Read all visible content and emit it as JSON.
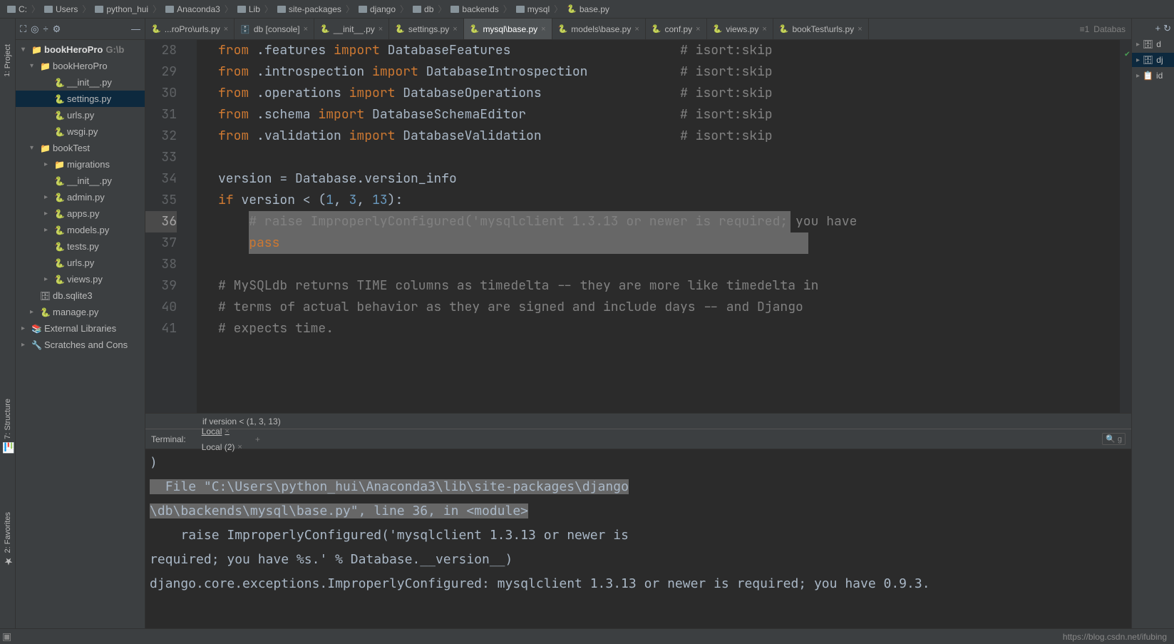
{
  "breadcrumb": [
    {
      "icon": "drive",
      "label": "C:"
    },
    {
      "icon": "folder",
      "label": "Users"
    },
    {
      "icon": "folder",
      "label": "python_hui"
    },
    {
      "icon": "folder",
      "label": "Anaconda3"
    },
    {
      "icon": "folder",
      "label": "Lib"
    },
    {
      "icon": "folder",
      "label": "site-packages"
    },
    {
      "icon": "folder",
      "label": "django"
    },
    {
      "icon": "folder",
      "label": "db"
    },
    {
      "icon": "folder",
      "label": "backends"
    },
    {
      "icon": "folder",
      "label": "mysql"
    },
    {
      "icon": "py",
      "label": "base.py"
    }
  ],
  "leftDock": {
    "project": "1: Project",
    "structure": "7: Structure",
    "favorites": "2: Favorites"
  },
  "projectTree": [
    {
      "depth": 0,
      "arrow": "▾",
      "icon": "📁",
      "label": "bookHeroPro",
      "suffix": " G:\\b",
      "bold": true
    },
    {
      "depth": 1,
      "arrow": "▾",
      "icon": "📁",
      "label": "bookHeroPro"
    },
    {
      "depth": 2,
      "arrow": "",
      "icon": "🐍",
      "label": "__init__.py"
    },
    {
      "depth": 2,
      "arrow": "",
      "icon": "🐍",
      "label": "settings.py",
      "selected": true
    },
    {
      "depth": 2,
      "arrow": "",
      "icon": "🐍",
      "label": "urls.py"
    },
    {
      "depth": 2,
      "arrow": "",
      "icon": "🐍",
      "label": "wsgi.py"
    },
    {
      "depth": 1,
      "arrow": "▾",
      "icon": "📁",
      "label": "bookTest"
    },
    {
      "depth": 2,
      "arrow": "▸",
      "icon": "📁",
      "label": "migrations"
    },
    {
      "depth": 2,
      "arrow": "",
      "icon": "🐍",
      "label": "__init__.py"
    },
    {
      "depth": 2,
      "arrow": "▸",
      "icon": "🐍",
      "label": "admin.py"
    },
    {
      "depth": 2,
      "arrow": "▸",
      "icon": "🐍",
      "label": "apps.py"
    },
    {
      "depth": 2,
      "arrow": "▸",
      "icon": "🐍",
      "label": "models.py"
    },
    {
      "depth": 2,
      "arrow": "",
      "icon": "🐍",
      "label": "tests.py"
    },
    {
      "depth": 2,
      "arrow": "",
      "icon": "🐍",
      "label": "urls.py"
    },
    {
      "depth": 2,
      "arrow": "▸",
      "icon": "🐍",
      "label": "views.py"
    },
    {
      "depth": 1,
      "arrow": "",
      "icon": "🗄",
      "label": "db.sqlite3"
    },
    {
      "depth": 1,
      "arrow": "▸",
      "icon": "🐍",
      "label": "manage.py"
    },
    {
      "depth": 0,
      "arrow": "▸",
      "icon": "📚",
      "label": "External Libraries"
    },
    {
      "depth": 0,
      "arrow": "▸",
      "icon": "🔧",
      "label": "Scratches and Cons"
    }
  ],
  "tabs": [
    {
      "icon": "py",
      "label": "...roPro\\urls.py"
    },
    {
      "icon": "db",
      "label": "db [console]"
    },
    {
      "icon": "py",
      "label": "__init__.py"
    },
    {
      "icon": "py",
      "label": "settings.py"
    },
    {
      "icon": "py",
      "label": "mysql\\base.py",
      "active": true
    },
    {
      "icon": "py",
      "label": "models\\base.py"
    },
    {
      "icon": "py",
      "label": "conf.py"
    },
    {
      "icon": "py",
      "label": "views.py"
    },
    {
      "icon": "py",
      "label": "bookTest\\urls.py"
    }
  ],
  "tabsRight": {
    "list": "≡1",
    "label": "Databas"
  },
  "code": {
    "startLine": 28,
    "lines": [
      {
        "n": 28,
        "seg": [
          [
            "kw",
            "from"
          ],
          [
            "op",
            " ."
          ],
          [
            "str-import",
            "features "
          ],
          [
            "kw",
            "import"
          ],
          [
            "op",
            " "
          ],
          [
            "str-import",
            "DatabaseFeatures"
          ]
        ],
        "comment": "# isort:skip"
      },
      {
        "n": 29,
        "seg": [
          [
            "kw",
            "from"
          ],
          [
            "op",
            " ."
          ],
          [
            "str-import",
            "introspection "
          ],
          [
            "kw",
            "import"
          ],
          [
            "op",
            " "
          ],
          [
            "str-import",
            "DatabaseIntrospection"
          ]
        ],
        "comment": "# isort:skip"
      },
      {
        "n": 30,
        "seg": [
          [
            "kw",
            "from"
          ],
          [
            "op",
            " ."
          ],
          [
            "str-import",
            "operations "
          ],
          [
            "kw",
            "import"
          ],
          [
            "op",
            " "
          ],
          [
            "str-import",
            "DatabaseOperations"
          ]
        ],
        "comment": "# isort:skip"
      },
      {
        "n": 31,
        "seg": [
          [
            "kw",
            "from"
          ],
          [
            "op",
            " ."
          ],
          [
            "str-import",
            "schema "
          ],
          [
            "kw",
            "import"
          ],
          [
            "op",
            " "
          ],
          [
            "str-import",
            "DatabaseSchemaEditor"
          ]
        ],
        "comment": "# isort:skip"
      },
      {
        "n": 32,
        "seg": [
          [
            "kw",
            "from"
          ],
          [
            "op",
            " ."
          ],
          [
            "str-import",
            "validation "
          ],
          [
            "kw",
            "import"
          ],
          [
            "op",
            " "
          ],
          [
            "str-import",
            "DatabaseValidation"
          ]
        ],
        "comment": "# isort:skip"
      },
      {
        "n": 33,
        "seg": []
      },
      {
        "n": 34,
        "seg": [
          [
            "op",
            "version = Database.version_info"
          ]
        ]
      },
      {
        "n": 35,
        "seg": [
          [
            "kw",
            "if"
          ],
          [
            "op",
            " version < ("
          ],
          [
            "num",
            "1"
          ],
          [
            "op",
            ", "
          ],
          [
            "num",
            "3"
          ],
          [
            "op",
            ", "
          ],
          [
            "num",
            "13"
          ],
          [
            "op",
            "):"
          ]
        ]
      },
      {
        "n": 36,
        "seg": [
          [
            "op",
            "    "
          ],
          [
            "cmt",
            "# raise ImproperlyConfigured('mysqlclient 1.3.13 or newer is required; you have"
          ]
        ],
        "highlighted": true,
        "active": true
      },
      {
        "n": 37,
        "seg": [
          [
            "op",
            "    "
          ],
          [
            "kw",
            "pass"
          ]
        ],
        "highlighted": true,
        "hl_end": 410
      },
      {
        "n": 38,
        "seg": []
      },
      {
        "n": 39,
        "seg": [
          [
            "cmt",
            "# MySQLdb returns TIME columns as timedelta -- they are more like timedelta in"
          ]
        ]
      },
      {
        "n": 40,
        "seg": [
          [
            "cmt",
            "# terms of actual behavior as they are signed and include days -- and Django"
          ]
        ]
      },
      {
        "n": 41,
        "seg": [
          [
            "cmt",
            "# expects time."
          ]
        ]
      }
    ],
    "crumb": "if version < (1, 3, 13)"
  },
  "rightDock": [
    {
      "icon": "🗄",
      "label": "d"
    },
    {
      "icon": "🗄",
      "label": "dj",
      "active": true
    },
    {
      "icon": "📋",
      "label": "id"
    }
  ],
  "terminalTabs": {
    "label": "Terminal:",
    "tabs": [
      {
        "label": "Local",
        "active": true
      },
      {
        "label": "Local (2)"
      }
    ]
  },
  "terminal": {
    "lines": [
      {
        "txt": ")"
      },
      {
        "txt": "  File \"C:\\Users\\python_hui\\Anaconda3\\lib\\site-packages\\django",
        "hl": true
      },
      {
        "txt": "\\db\\backends\\mysql\\base.py\", line 36, in <module>",
        "hl": true
      },
      {
        "txt": "    raise ImproperlyConfigured('mysqlclient 1.3.13 or newer is "
      },
      {
        "txt": "required; you have %s.' % Database.__version__)"
      },
      {
        "txt": "django.core.exceptions.ImproperlyConfigured: mysqlclient 1.3.13 or newer is required; you have 0.9.3."
      }
    ]
  },
  "statusBar": {
    "url": "https://blog.csdn.net/ifubing"
  }
}
